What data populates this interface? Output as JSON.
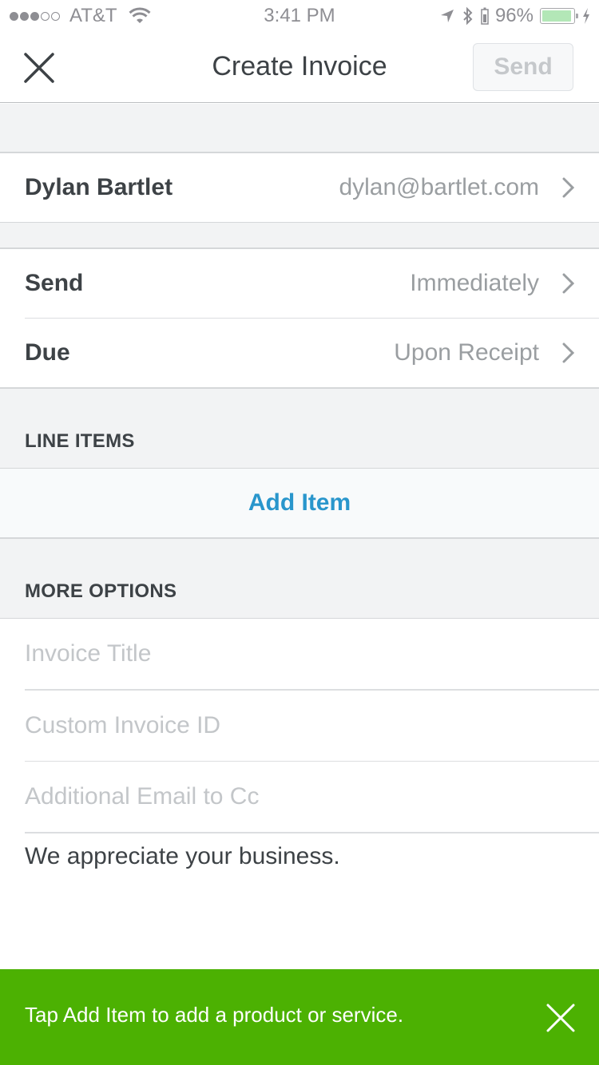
{
  "status_bar": {
    "signal_filled": 3,
    "signal_total": 5,
    "carrier": "AT&T",
    "wifi_icon": "wifi-icon",
    "time": "3:41 PM",
    "location_icon": "location-arrow-icon",
    "bluetooth_icon": "bluetooth-icon",
    "battery_percent_label": "96%",
    "battery_level": 0.96,
    "charging_icon": "bolt-icon",
    "battery_color": "#b3e7b7"
  },
  "nav": {
    "close_icon": "close-icon",
    "title": "Create Invoice",
    "send_label": "Send",
    "send_enabled": false
  },
  "customer": {
    "name": "Dylan Bartlet",
    "email": "dylan@bartlet.com"
  },
  "schedule": [
    {
      "label": "Send",
      "value": "Immediately"
    },
    {
      "label": "Due",
      "value": "Upon Receipt"
    }
  ],
  "line_items": {
    "header": "LINE ITEMS",
    "add_label": "Add Item",
    "accent_color": "#2996cc"
  },
  "more_options": {
    "header": "MORE OPTIONS",
    "fields": [
      {
        "placeholder": "Invoice Title",
        "value": ""
      },
      {
        "placeholder": "Custom Invoice ID",
        "value": ""
      },
      {
        "placeholder": "Additional Email to Cc",
        "value": ""
      }
    ],
    "memo": "We appreciate your business."
  },
  "banner": {
    "message": "Tap Add Item to add a product or service.",
    "close_icon": "close-icon",
    "color": "#4cb102"
  }
}
